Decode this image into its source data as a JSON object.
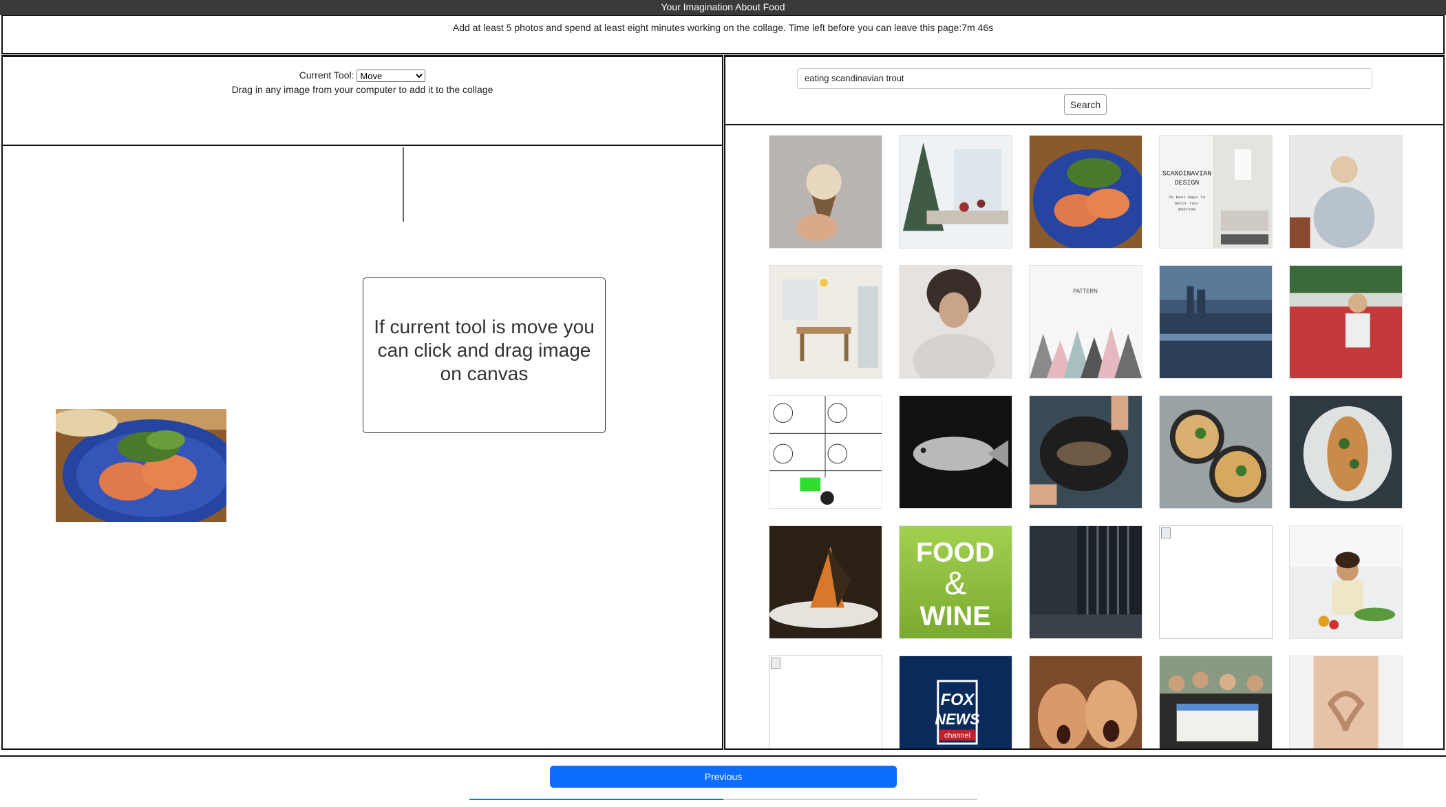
{
  "window": {
    "title": "Your Imagination About Food"
  },
  "instructions": {
    "text": "Add at least 5 photos and spend at least eight minutes working on the collage. Time left before you can leave this page:7m 46s"
  },
  "tools": {
    "current_tool_label": "Current Tool:",
    "selected_tool": "Move",
    "drag_hint": "Drag in any image from your computer to add it to the collage"
  },
  "canvas": {
    "tooltip": "If current tool is move you can click and drag image on canvas",
    "placed_images": [
      {
        "depicts": "salmon salad plate"
      }
    ]
  },
  "search": {
    "query": "eating scandinavian trout",
    "button_label": "Search"
  },
  "results": {
    "thumbnails": [
      {
        "depicts": "ice cream cone"
      },
      {
        "depicts": "christmas table"
      },
      {
        "depicts": "salmon salad plate"
      },
      {
        "depicts": "scandinavian design",
        "overlay_lines": [
          "SCANDINAVIAN",
          "DESIGN",
          "20 Best Ways To",
          "Decor Your",
          "Bedroom"
        ]
      },
      {
        "depicts": "woman reading"
      },
      {
        "depicts": "dining room"
      },
      {
        "depicts": "woman hiding face"
      },
      {
        "depicts": "pattern triangles",
        "overlay_lines": [
          "PATTERN"
        ]
      },
      {
        "depicts": "city harbor"
      },
      {
        "depicts": "woman at red tables"
      },
      {
        "depicts": "rage comic"
      },
      {
        "depicts": "trout fish"
      },
      {
        "depicts": "hands grilling fish"
      },
      {
        "depicts": "noodle bowls"
      },
      {
        "depicts": "fish dish on plate"
      },
      {
        "depicts": "gourmet plate"
      },
      {
        "depicts": "food and wine logo",
        "overlay_lines": [
          "FOOD",
          "&",
          "WINE"
        ]
      },
      {
        "depicts": "dark room"
      },
      {
        "depicts": "broken image"
      },
      {
        "depicts": "woman cooking"
      },
      {
        "depicts": "broken image"
      },
      {
        "depicts": "fox news logo",
        "overlay_lines": [
          "FOX",
          "NEWS",
          "channel"
        ]
      },
      {
        "depicts": "screaming faces"
      },
      {
        "depicts": "group with check"
      },
      {
        "depicts": "heart hands on belly"
      }
    ]
  },
  "navigation": {
    "previous_label": "Previous",
    "progress_fraction": 0.5
  },
  "colors": {
    "titlebar": "#3a3a3a",
    "primary": "#0d6efd",
    "food_wine_green": "#8bc53f",
    "fox_blue": "#0a2a5c"
  }
}
